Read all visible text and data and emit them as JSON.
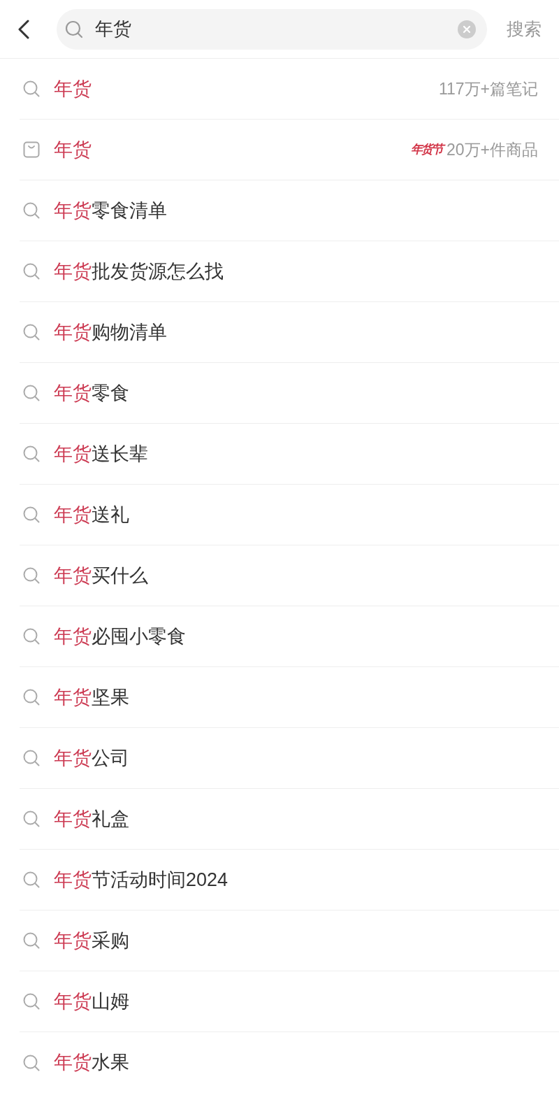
{
  "header": {
    "search": {
      "value": "年货"
    },
    "action": "搜索"
  },
  "suggestions": [
    {
      "kind": "query",
      "match": "年货",
      "count": "117万+篇笔记"
    },
    {
      "kind": "goods",
      "match": "年货",
      "badge": "年货节",
      "count": "20万+件商品"
    },
    {
      "kind": "query",
      "match": "年货",
      "rest": "零食清单"
    },
    {
      "kind": "query",
      "match": "年货",
      "rest": "批发货源怎么找"
    },
    {
      "kind": "query",
      "match": "年货",
      "rest": "购物清单"
    },
    {
      "kind": "query",
      "match": "年货",
      "rest": "零食"
    },
    {
      "kind": "query",
      "match": "年货",
      "rest": "送长辈"
    },
    {
      "kind": "query",
      "match": "年货",
      "rest": "送礼"
    },
    {
      "kind": "query",
      "match": "年货",
      "rest": "买什么"
    },
    {
      "kind": "query",
      "match": "年货",
      "rest": "必囤小零食"
    },
    {
      "kind": "query",
      "match": "年货",
      "rest": "坚果"
    },
    {
      "kind": "query",
      "match": "年货",
      "rest": "公司"
    },
    {
      "kind": "query",
      "match": "年货",
      "rest": "礼盒"
    },
    {
      "kind": "query",
      "match": "年货",
      "rest": "节活动时间2024"
    },
    {
      "kind": "query",
      "match": "年货",
      "rest": "采购"
    },
    {
      "kind": "query",
      "match": "年货",
      "rest": "山姆"
    },
    {
      "kind": "query",
      "match": "年货",
      "rest": "水果"
    }
  ]
}
